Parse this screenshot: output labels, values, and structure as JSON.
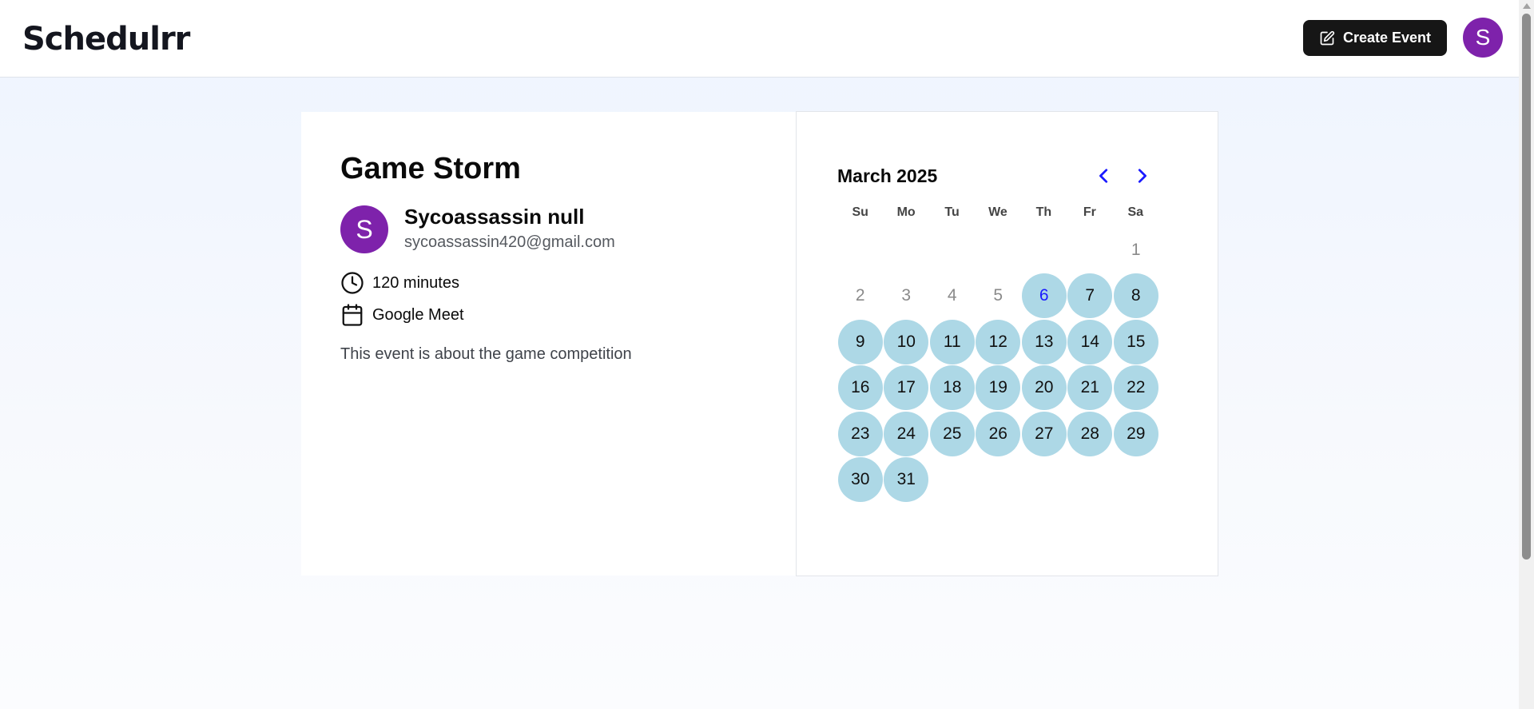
{
  "header": {
    "logo_text": "Schedulrr",
    "create_button_label": "Create Event",
    "user_initial": "S"
  },
  "event": {
    "title": "Game Storm",
    "host": {
      "initial": "S",
      "name": "Sycoassassin null",
      "email": "sycoassassin420@gmail.com"
    },
    "duration": "120 minutes",
    "location": "Google Meet",
    "description": "This event is about the game competition"
  },
  "calendar": {
    "month_label": "March 2025",
    "weekdays": [
      "Su",
      "Mo",
      "Tu",
      "We",
      "Th",
      "Fr",
      "Sa"
    ],
    "leading_blanks": 6,
    "days": [
      {
        "label": "1",
        "state": "disabled"
      },
      {
        "label": "2",
        "state": "disabled"
      },
      {
        "label": "3",
        "state": "disabled"
      },
      {
        "label": "4",
        "state": "disabled"
      },
      {
        "label": "5",
        "state": "disabled"
      },
      {
        "label": "6",
        "state": "today"
      },
      {
        "label": "7",
        "state": "available"
      },
      {
        "label": "8",
        "state": "available"
      },
      {
        "label": "9",
        "state": "available"
      },
      {
        "label": "10",
        "state": "available"
      },
      {
        "label": "11",
        "state": "available"
      },
      {
        "label": "12",
        "state": "available"
      },
      {
        "label": "13",
        "state": "available"
      },
      {
        "label": "14",
        "state": "available"
      },
      {
        "label": "15",
        "state": "available"
      },
      {
        "label": "16",
        "state": "available"
      },
      {
        "label": "17",
        "state": "available"
      },
      {
        "label": "18",
        "state": "available"
      },
      {
        "label": "19",
        "state": "available"
      },
      {
        "label": "20",
        "state": "available"
      },
      {
        "label": "21",
        "state": "available"
      },
      {
        "label": "22",
        "state": "available"
      },
      {
        "label": "23",
        "state": "available"
      },
      {
        "label": "24",
        "state": "available"
      },
      {
        "label": "25",
        "state": "available"
      },
      {
        "label": "26",
        "state": "available"
      },
      {
        "label": "27",
        "state": "available"
      },
      {
        "label": "28",
        "state": "available"
      },
      {
        "label": "29",
        "state": "available"
      },
      {
        "label": "30",
        "state": "available"
      },
      {
        "label": "31",
        "state": "available"
      }
    ]
  },
  "colors": {
    "avatar": "#7e22ab",
    "available_day": "#add8e6",
    "today_text": "#1a1aff",
    "nav_arrow": "#1a1aff",
    "button_bg": "#161616"
  },
  "icons": {
    "create": "edit-square-icon",
    "duration": "clock-icon",
    "location": "calendar-icon",
    "prev": "chevron-left-icon",
    "next": "chevron-right-icon"
  }
}
